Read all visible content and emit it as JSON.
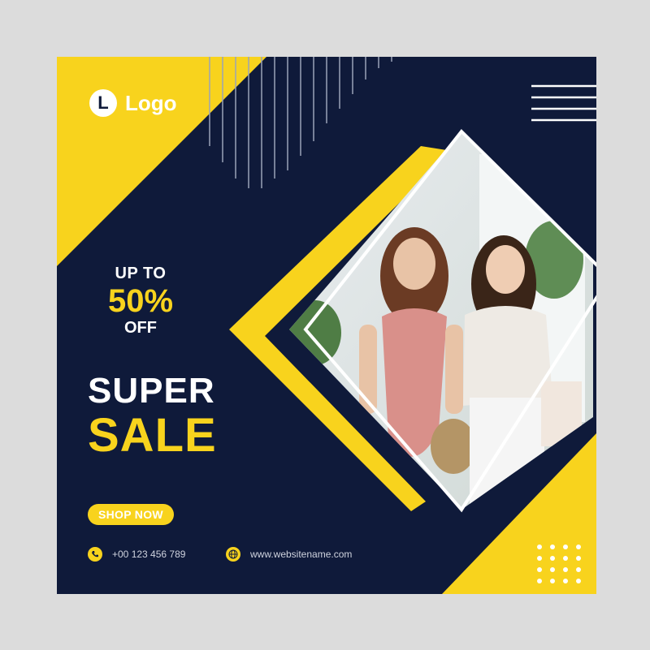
{
  "brand": {
    "logo_letter": "L",
    "logo_text": "Logo"
  },
  "offer": {
    "line1": "UP TO",
    "line2": "50%",
    "line3": "OFF"
  },
  "headline": {
    "line1": "SUPER",
    "line2": "SALE"
  },
  "cta": {
    "label": "SHOP NOW"
  },
  "contact": {
    "phone": "+00 123 456  789",
    "website": "www.websitename.com"
  },
  "colors": {
    "navy": "#0f1a3a",
    "yellow": "#f8d31d",
    "white": "#ffffff"
  },
  "icons": [
    "phone-icon",
    "globe-icon"
  ]
}
